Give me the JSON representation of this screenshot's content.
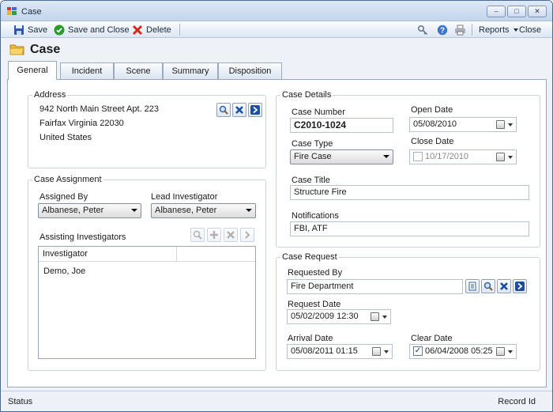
{
  "window": {
    "title": "Case",
    "minimize": "–",
    "maximize": "□",
    "close": "✕"
  },
  "toolbar": {
    "save": "Save",
    "save_close": "Save and Close",
    "delete": "Delete",
    "reports": "Reports",
    "close": "Close"
  },
  "header": {
    "title": "Case"
  },
  "tabs": [
    "General",
    "Incident",
    "Scene",
    "Summary",
    "Disposition"
  ],
  "address": {
    "group_label": "Address",
    "line1": "942 North Main Street Apt. 223",
    "line2": "Fairfax Virginia 22030",
    "line3": "United States"
  },
  "assignment": {
    "group_label": "Case Assignment",
    "assigned_by_label": "Assigned By",
    "assigned_by_value": "Albanese, Peter",
    "lead_label": "Lead Investigator",
    "lead_value": "Albanese, Peter",
    "assisting_label": "Assisting Investigators",
    "grid_header": "Investigator",
    "rows": [
      "Demo, Joe"
    ]
  },
  "details": {
    "group_label": "Case Details",
    "case_number_label": "Case Number",
    "case_number_value": "C2010-1024",
    "open_date_label": "Open Date",
    "open_date_value": "05/08/2010",
    "case_type_label": "Case Type",
    "case_type_value": "Fire Case",
    "close_date_label": "Close Date",
    "close_date_value": "10/17/2010",
    "close_date_checked": false,
    "case_title_label": "Case Title",
    "case_title_value": "Structure Fire",
    "notifications_label": "Notifications",
    "notifications_value": "FBI, ATF"
  },
  "request": {
    "group_label": "Case Request",
    "requested_by_label": "Requested By",
    "requested_by_value": "Fire Department",
    "request_date_label": "Request Date",
    "request_date_value": "05/02/2009 12:30",
    "arrival_date_label": "Arrival Date",
    "arrival_date_value": "05/08/2011 01:15",
    "clear_date_label": "Clear Date",
    "clear_date_value": "06/04/2008 05:25",
    "clear_date_checked": true
  },
  "status": {
    "left": "Status",
    "right": "Record Id"
  },
  "colors": {
    "accent": "#1a4fa3",
    "delete_red": "#d8281d",
    "ok_green": "#2a9b2a",
    "title_gradient_top": "#dde8f6"
  }
}
